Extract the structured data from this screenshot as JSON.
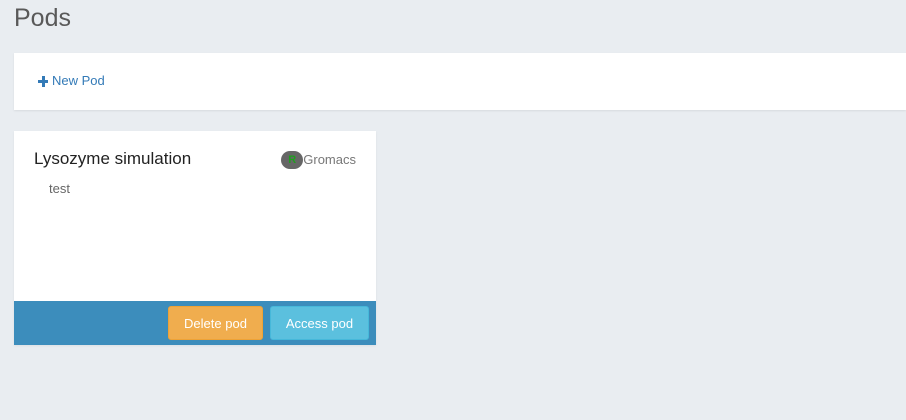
{
  "page": {
    "title": "Pods"
  },
  "toolbar": {
    "new_pod_label": "New Pod",
    "new_pod_icon": "plus-icon"
  },
  "pods": [
    {
      "name": "Lysozyme simulation",
      "app": {
        "icon_letter": "R",
        "label": "Gromacs"
      },
      "description": "test",
      "delete_label": "Delete pod",
      "access_label": "Access pod"
    }
  ],
  "colors": {
    "background": "#e9edf1",
    "link": "#337ab7",
    "card_footer": "#3c8dbc",
    "delete_button": "#f0ad4e",
    "access_button": "#5bc0de"
  }
}
